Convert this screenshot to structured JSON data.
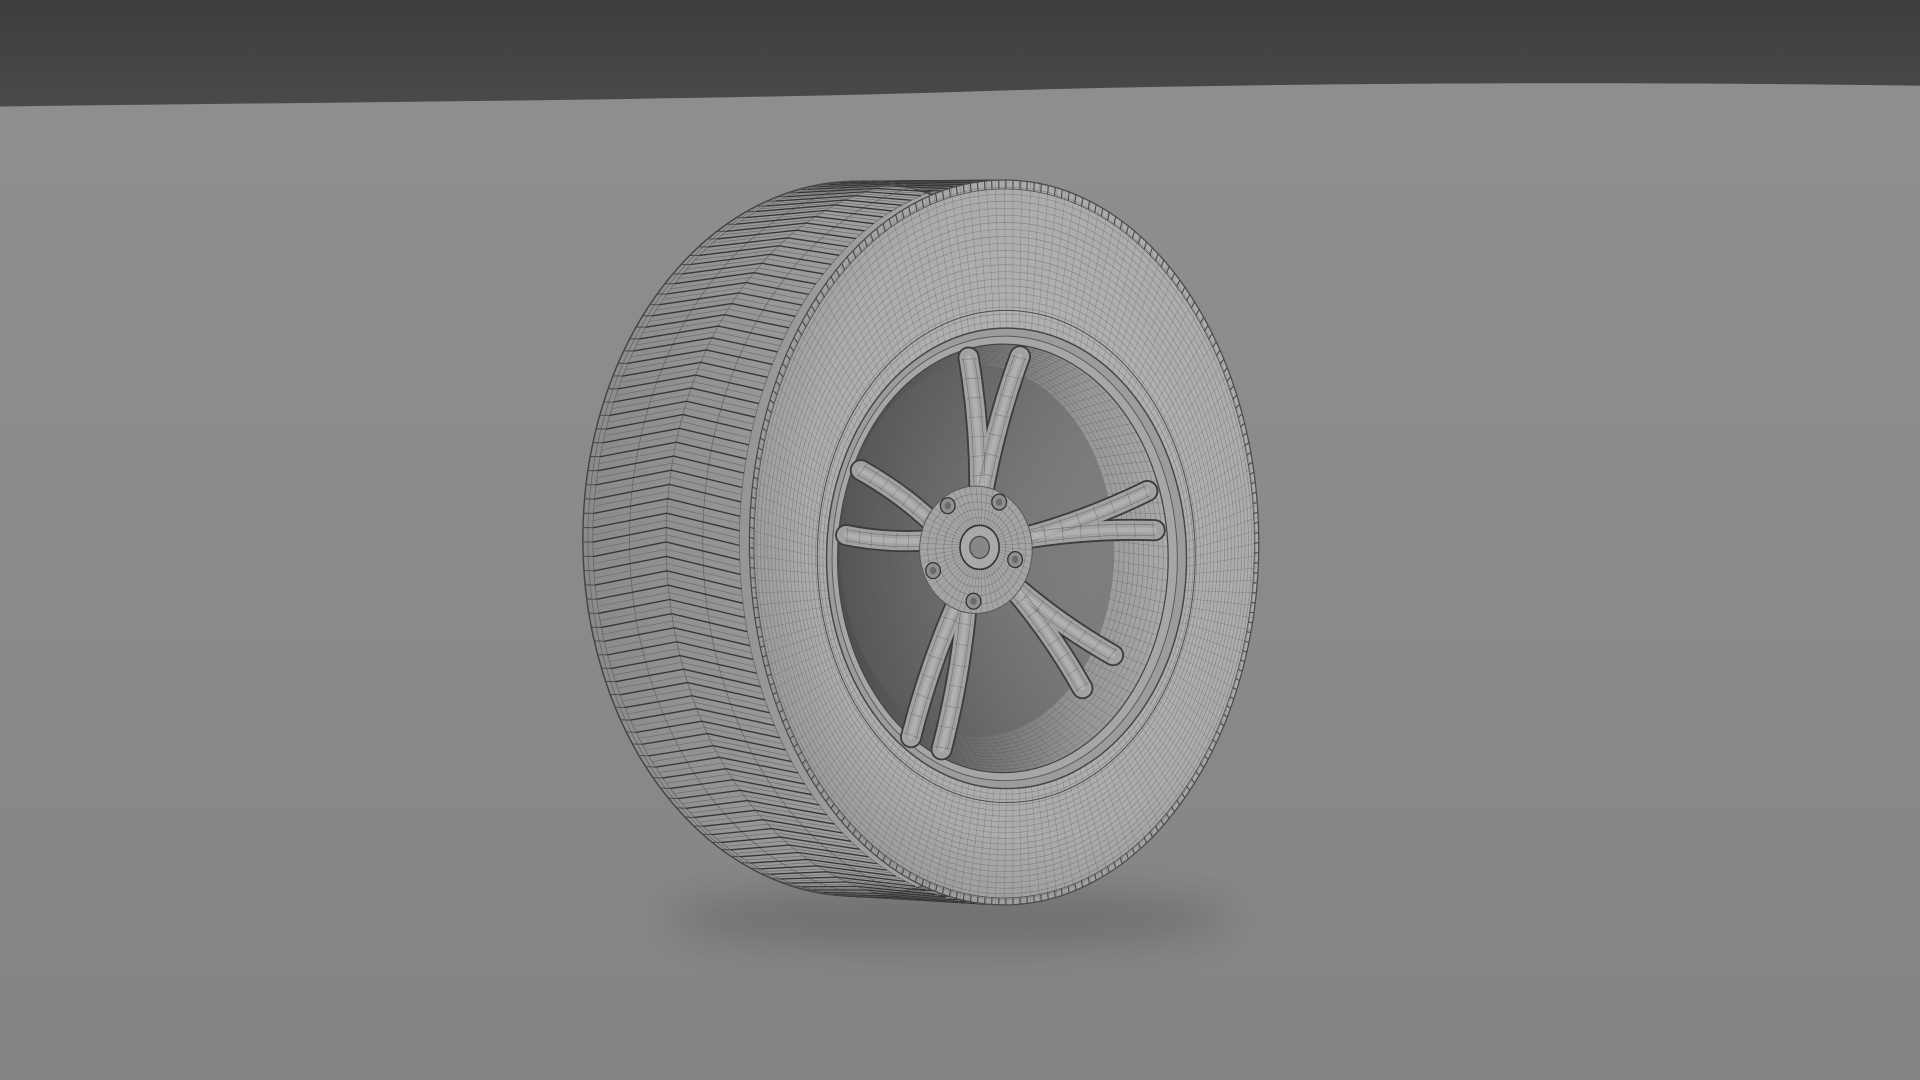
{
  "scene": {
    "colors": {
      "backdrop_top": "#434343",
      "floor": "#8b8b8b",
      "tire": "#a9a9a9",
      "tread": "#979797",
      "tread_line": "#363636",
      "wire": "#555555",
      "rim": "#a2a2a2",
      "rim_shadow": "#5c5c5c",
      "outline": "#444444"
    }
  }
}
